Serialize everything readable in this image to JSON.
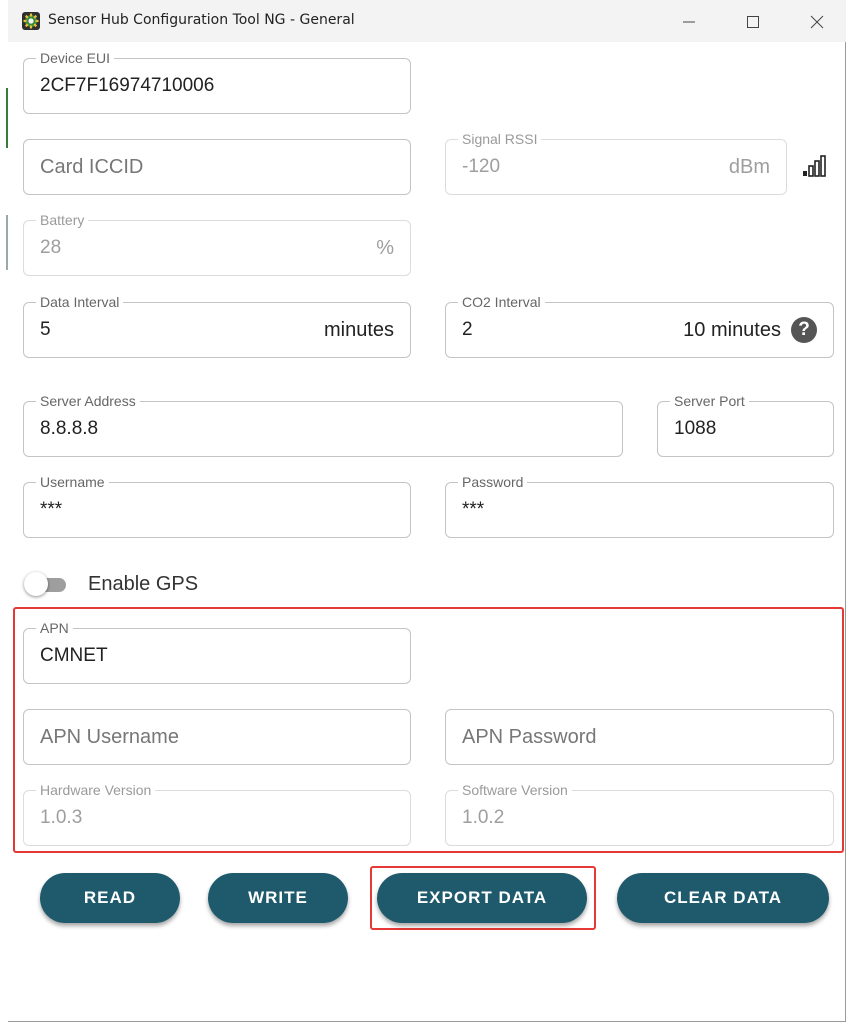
{
  "window": {
    "title": "Sensor Hub Configuration Tool NG - General",
    "controls": {
      "minimize": "minimize",
      "maximize": "maximize",
      "close": "close"
    }
  },
  "fields": {
    "device_eui": {
      "label": "Device EUI",
      "value": "2CF7F16974710006"
    },
    "card_iccid": {
      "placeholder": "Card ICCID"
    },
    "signal_rssi": {
      "label": "Signal RSSI",
      "value": "-120",
      "unit": "dBm"
    },
    "battery": {
      "label": "Battery",
      "value": "28",
      "unit": "%"
    },
    "data_interval": {
      "label": "Data Interval",
      "value": "5",
      "unit": "minutes"
    },
    "co2_interval": {
      "label": "CO2 Interval",
      "value": "2",
      "unit": "10 minutes"
    },
    "server_address": {
      "label": "Server Address",
      "value": "8.8.8.8"
    },
    "server_port": {
      "label": "Server Port",
      "value": "1088"
    },
    "username": {
      "label": "Username",
      "value": "***"
    },
    "password": {
      "label": "Password",
      "value": "***"
    },
    "apn": {
      "label": "APN",
      "value": "CMNET"
    },
    "apn_username": {
      "placeholder": "APN Username"
    },
    "apn_password": {
      "placeholder": "APN Password"
    },
    "hardware_version": {
      "label": "Hardware Version",
      "value": "1.0.3"
    },
    "software_version": {
      "label": "Software Version",
      "value": "1.0.2"
    }
  },
  "gps_toggle": {
    "label": "Enable GPS",
    "enabled": false
  },
  "buttons": {
    "read": "READ",
    "write": "WRITE",
    "export": "EXPORT DATA",
    "clear": "CLEAR DATA"
  },
  "colors": {
    "button": "#1e5a6c",
    "highlight": "#e53935",
    "app_icon_green": "#3a8a3a"
  },
  "icons": {
    "app": "gear-icon",
    "signal": "signal-strength-icon",
    "help": "help-icon"
  }
}
